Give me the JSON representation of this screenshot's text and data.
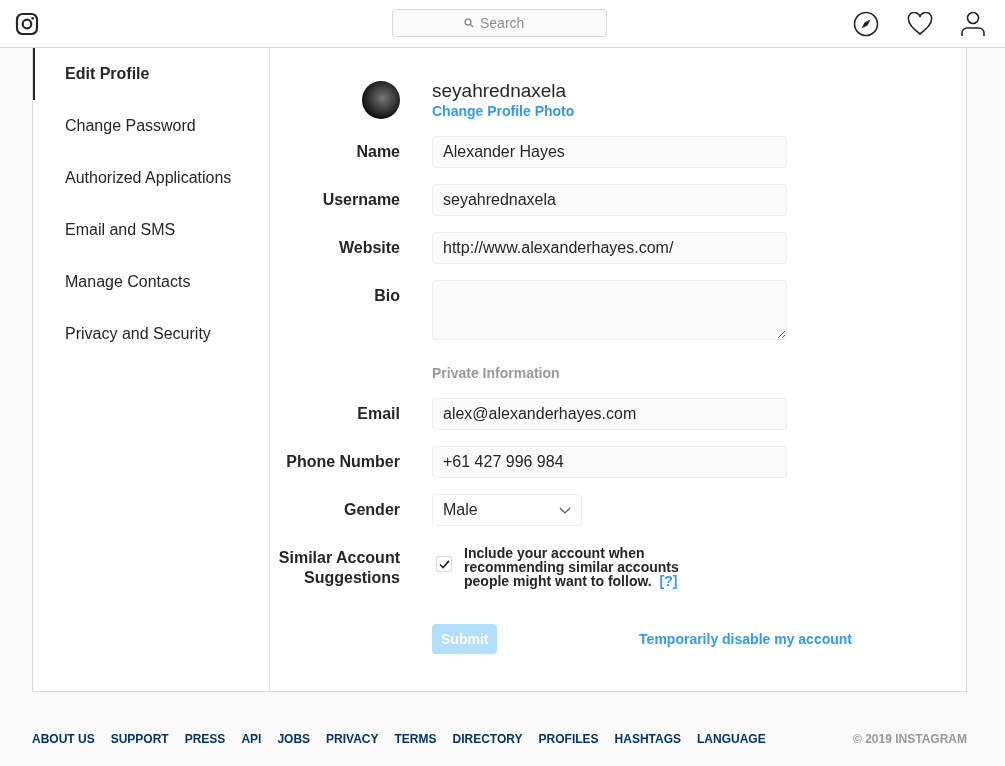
{
  "header": {
    "search": {
      "placeholder": "Search"
    }
  },
  "sidebar": {
    "items": [
      {
        "label": "Edit Profile",
        "selected": true
      },
      {
        "label": "Change Password",
        "selected": false
      },
      {
        "label": "Authorized Applications",
        "selected": false
      },
      {
        "label": "Email and SMS",
        "selected": false
      },
      {
        "label": "Manage Contacts",
        "selected": false
      },
      {
        "label": "Privacy and Security",
        "selected": false
      }
    ]
  },
  "profile": {
    "username": "seyahrednaxela",
    "change_photo": "Change Profile Photo"
  },
  "form": [
    {
      "kind": "input",
      "label": "Name",
      "value": "Alexander Hayes"
    },
    {
      "kind": "input",
      "label": "Username",
      "value": "seyahrednaxela"
    },
    {
      "kind": "input",
      "label": "Website",
      "value": "http://www.alexanderhayes.com/"
    },
    {
      "kind": "textarea",
      "label": "Bio"
    },
    {
      "kind": "section",
      "label": "Private Information"
    },
    {
      "kind": "input",
      "label": "Email",
      "value": "alex@alexanderhayes.com"
    },
    {
      "kind": "input",
      "label": "Phone Number",
      "value": "+61 427 996 984"
    },
    {
      "kind": "select",
      "label": "Gender",
      "value": "Male"
    },
    {
      "kind": "checkbox",
      "label": "Similar Account Suggestions",
      "text": "Include your account when recommending similar accounts people might want to follow.",
      "help": "[?]",
      "checked": true
    }
  ],
  "actions": {
    "submit": {
      "label": "Submit",
      "disabled": true
    },
    "disable_link": "Temporarily disable my account"
  },
  "footer": {
    "links": [
      "ABOUT US",
      "SUPPORT",
      "PRESS",
      "API",
      "JOBS",
      "PRIVACY",
      "TERMS",
      "DIRECTORY",
      "PROFILES",
      "HASHTAGS",
      "LANGUAGE"
    ],
    "copyright": "© 2019 INSTAGRAM"
  }
}
